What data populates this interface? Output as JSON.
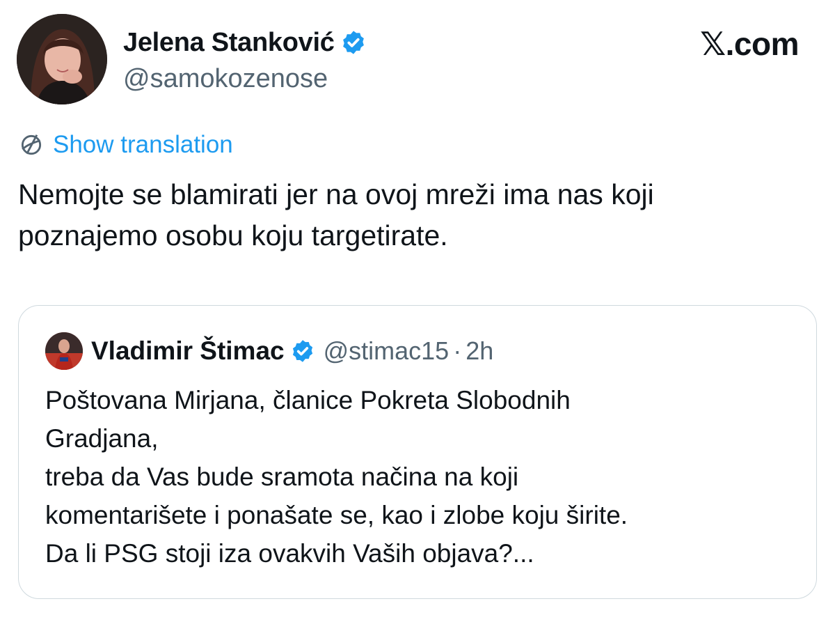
{
  "author": {
    "name": "Jelena Stanković",
    "handle": "@samokozenose",
    "verified": true,
    "avatar_icon": "person-avatar"
  },
  "site": {
    "logo_text": "𝕏.com"
  },
  "translation": {
    "label": "Show translation",
    "icon": "translate-globe-icon"
  },
  "tweet": {
    "lines": [
      "Nemojte se blamirati jer na ovoj mreži ima nas koji",
      "poznajemo osobu koju targetirate."
    ]
  },
  "quoted_tweet": {
    "name": "Vladimir Štimac",
    "verified": true,
    "handle": "@stimac15",
    "separator": "·",
    "time": "2h",
    "lines": [
      "Poštovana Mirjana, članice Pokreta Slobodnih",
      "Gradjana,",
      "treba da Vas bude sramota načina na koji",
      "komentarišete i ponašate se, kao i zlobe koju širite.",
      "Da li PSG stoji iza ovakvih Vaših objava?..."
    ]
  },
  "colors": {
    "accent": "#1d9bf0",
    "text_primary": "#0f1419",
    "text_secondary": "#536471",
    "border": "#cfd9de"
  }
}
